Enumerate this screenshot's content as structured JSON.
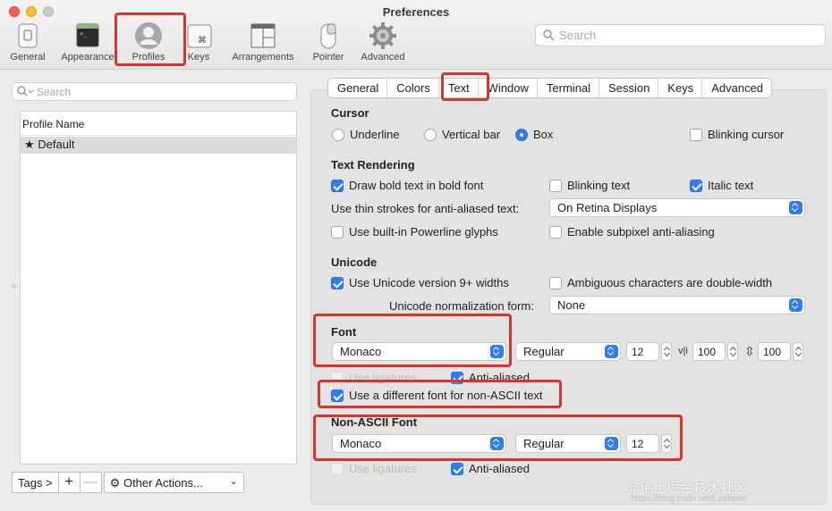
{
  "window": {
    "title": "Preferences"
  },
  "toolbar": {
    "items": [
      {
        "label": "General",
        "icon": "general-icon"
      },
      {
        "label": "Appearance",
        "icon": "appearance-icon"
      },
      {
        "label": "Profiles",
        "icon": "profiles-icon",
        "selected": true
      },
      {
        "label": "Keys",
        "icon": "keys-icon"
      },
      {
        "label": "Arrangements",
        "icon": "arrangements-icon"
      },
      {
        "label": "Pointer",
        "icon": "pointer-icon"
      },
      {
        "label": "Advanced",
        "icon": "advanced-gear-icon"
      }
    ],
    "search_placeholder": "Search"
  },
  "sidebar": {
    "search_placeholder": "Search",
    "list_header": "Profile Name",
    "profiles": [
      {
        "name": "★ Default",
        "selected": true
      }
    ],
    "buttons": {
      "tags": "Tags >",
      "add": "+",
      "remove": "—",
      "other_actions": "Other Actions...",
      "gear": "⚙"
    }
  },
  "tabs": [
    "General",
    "Colors",
    "Text",
    "Window",
    "Terminal",
    "Session",
    "Keys",
    "Advanced"
  ],
  "active_tab": "Text",
  "cursor": {
    "heading": "Cursor",
    "underline": "Underline",
    "vertical_bar": "Vertical bar",
    "box": "Box",
    "selected": "Box",
    "blinking": "Blinking cursor"
  },
  "text_rendering": {
    "heading": "Text Rendering",
    "draw_bold": "Draw bold text in bold font",
    "blinking_text": "Blinking text",
    "italic_text": "Italic text",
    "thin_strokes_label": "Use thin strokes for anti-aliased text:",
    "thin_strokes_value": "On Retina Displays",
    "powerline": "Use built-in Powerline glyphs",
    "subpixel": "Enable subpixel anti-aliasing"
  },
  "unicode": {
    "heading": "Unicode",
    "v9_widths": "Use Unicode version 9+ widths",
    "ambiguous": "Ambiguous characters are double-width",
    "normalization_label": "Unicode normalization form:",
    "normalization_value": "None"
  },
  "font": {
    "heading": "Font",
    "family": "Monaco",
    "style": "Regular",
    "size": "12",
    "h_spacing_glyph": "v|i",
    "h_spacing": "100",
    "v_spacing_glyph": "⇳",
    "v_spacing": "100",
    "use_ligatures": "Use ligatures",
    "anti_aliased": "Anti-aliased",
    "different_non_ascii": "Use a different font for non-ASCII text"
  },
  "non_ascii_font": {
    "heading": "Non-ASCII Font",
    "family": "Monaco",
    "style": "Regular",
    "size": "12",
    "use_ligatures": "Use ligatures",
    "anti_aliased": "Anti-aliased"
  },
  "watermark": {
    "text": "@稀土掘金技术社区",
    "sub": "https://blog.csdn.net/Lindqvw"
  },
  "colors": {
    "accent": "#2f7cf6",
    "highlight": "#d8342c"
  }
}
